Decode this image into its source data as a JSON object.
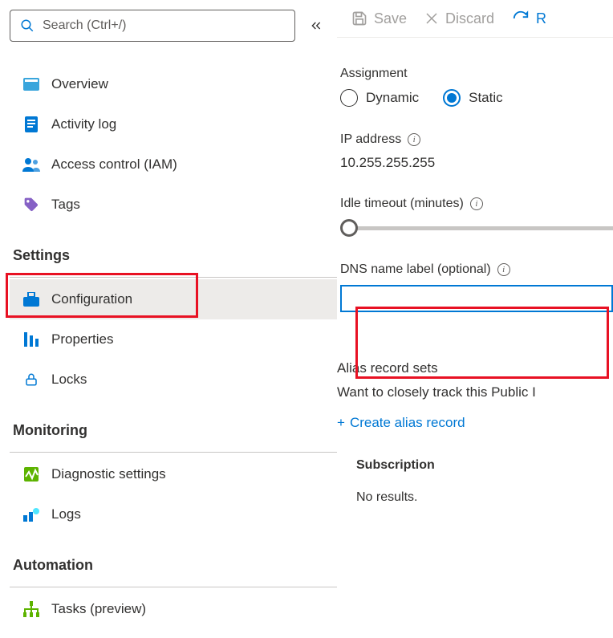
{
  "search": {
    "placeholder": "Search (Ctrl+/)"
  },
  "sidebar": {
    "items": [
      {
        "label": "Overview"
      },
      {
        "label": "Activity log"
      },
      {
        "label": "Access control (IAM)"
      },
      {
        "label": "Tags"
      }
    ],
    "sections": {
      "settings": {
        "title": "Settings",
        "items": [
          {
            "label": "Configuration"
          },
          {
            "label": "Properties"
          },
          {
            "label": "Locks"
          }
        ]
      },
      "monitoring": {
        "title": "Monitoring",
        "items": [
          {
            "label": "Diagnostic settings"
          },
          {
            "label": "Logs"
          }
        ]
      },
      "automation": {
        "title": "Automation",
        "items": [
          {
            "label": "Tasks (preview)"
          }
        ]
      }
    }
  },
  "toolbar": {
    "save_label": "Save",
    "discard_label": "Discard",
    "refresh_glyph": "R"
  },
  "main": {
    "assignment": {
      "label": "Assignment",
      "options": {
        "dynamic": "Dynamic",
        "static": "Static"
      },
      "selected": "static"
    },
    "ip_address": {
      "label": "IP address",
      "value": "10.255.255.255"
    },
    "idle_timeout": {
      "label": "Idle timeout (minutes)"
    },
    "dns_label": {
      "label": "DNS name label (optional)",
      "value": ""
    },
    "alias": {
      "title": "Alias record sets",
      "description": "Want to closely track this Public I",
      "create_label": "Create alias record"
    },
    "subscription": {
      "title": "Subscription",
      "no_results": "No results."
    }
  }
}
